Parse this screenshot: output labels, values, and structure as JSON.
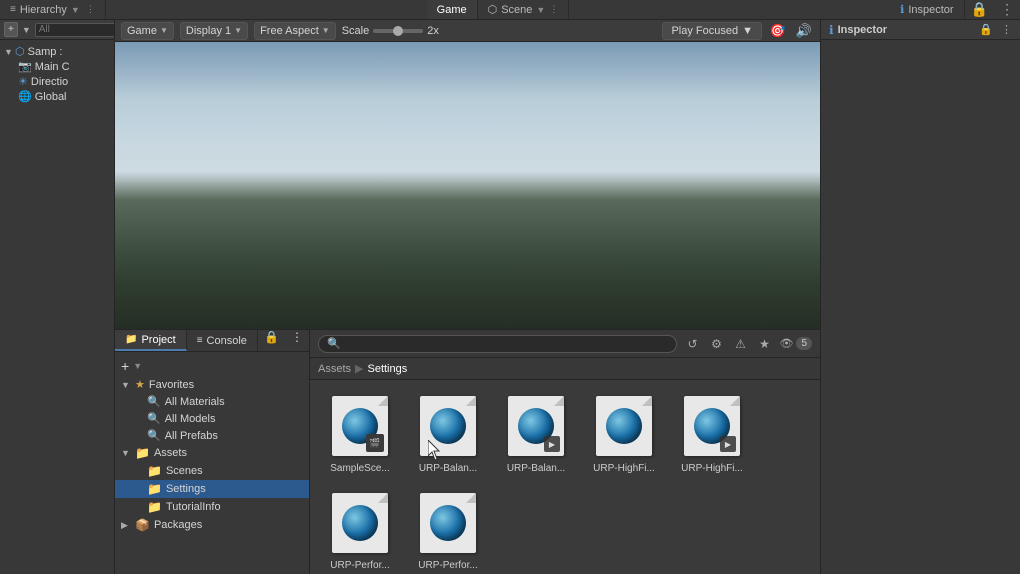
{
  "tabs": {
    "hierarchy": {
      "label": "Hierarchy",
      "icon": "≡"
    },
    "game": {
      "label": "Game",
      "icon": "▶"
    },
    "scene": {
      "label": "Scene",
      "icon": "⬡"
    },
    "inspector": {
      "label": "Inspector",
      "icon": "ℹ"
    }
  },
  "game_toolbar": {
    "display_label": "Game",
    "display_option": "Display 1",
    "aspect_label": "Free Aspect",
    "scale_label": "Scale",
    "scale_value": "2x",
    "play_label": "Play Focused",
    "mute_icon": "🔊"
  },
  "hierarchy": {
    "add_btn": "+",
    "search_placeholder": "All",
    "tree": [
      {
        "label": "Samp :",
        "level": 0,
        "expanded": true,
        "icon": "scene"
      },
      {
        "label": "Main C",
        "level": 1,
        "icon": "camera"
      },
      {
        "label": "Directio",
        "level": 1,
        "icon": "light"
      },
      {
        "label": "Global",
        "level": 1,
        "icon": "global"
      }
    ]
  },
  "bottom_tabs": {
    "project": {
      "label": "Project",
      "icon": "📁"
    },
    "console": {
      "label": "Console",
      "icon": "≡"
    }
  },
  "sidebar_tree": {
    "add_btn": "+",
    "sections": [
      {
        "label": "Favorites",
        "icon": "★",
        "expanded": true,
        "items": [
          {
            "label": "All Materials"
          },
          {
            "label": "All Models"
          },
          {
            "label": "All Prefabs"
          }
        ]
      },
      {
        "label": "Assets",
        "icon": "📁",
        "expanded": true,
        "items": [
          {
            "label": "Scenes"
          },
          {
            "label": "Settings",
            "selected": true
          },
          {
            "label": "TutorialInfo"
          }
        ]
      },
      {
        "label": "Packages",
        "icon": "📦",
        "expanded": false,
        "items": []
      }
    ]
  },
  "breadcrumb": {
    "root": "Assets",
    "current": "Settings"
  },
  "files": [
    {
      "id": 0,
      "name": "SampleSce...",
      "has_play": false,
      "type": "scene"
    },
    {
      "id": 1,
      "name": "URP-Balan...",
      "has_play": false,
      "type": "asset"
    },
    {
      "id": 2,
      "name": "URP-Balan...",
      "has_play": true,
      "type": "asset"
    },
    {
      "id": 3,
      "name": "URP-HighFi...",
      "has_play": false,
      "type": "asset"
    },
    {
      "id": 4,
      "name": "URP-HighFi...",
      "has_play": true,
      "type": "asset"
    },
    {
      "id": 5,
      "name": "URP-Perfor...",
      "has_play": false,
      "type": "asset"
    },
    {
      "id": 6,
      "name": "URP-Perfor...",
      "has_play": false,
      "type": "asset_bottom"
    }
  ],
  "toolbar_icons": {
    "save": "💾",
    "history": "↺",
    "star": "★",
    "warning": "⚠",
    "eye": "👁",
    "badge": "5"
  },
  "inspector": {
    "title": "Inspector",
    "icon": "ℹ"
  }
}
